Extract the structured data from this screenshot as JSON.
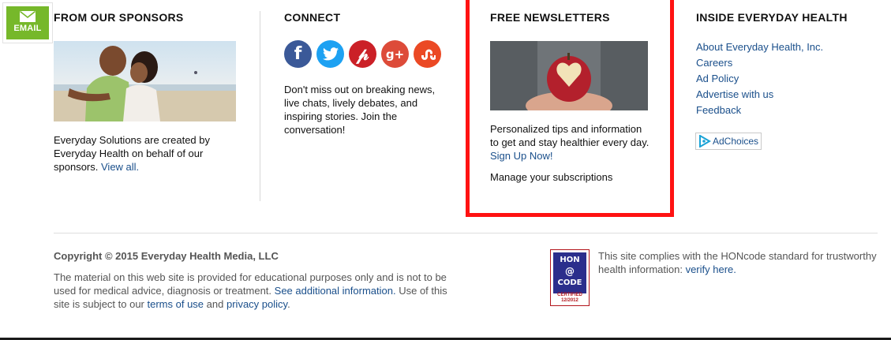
{
  "email": {
    "label": "EMAIL",
    "icon": "envelope-icon"
  },
  "sponsors": {
    "heading": "FROM OUR SPONSORS",
    "text": "Everyday Solutions are created by Everyday Health on behalf of our sponsors.",
    "link": "View all."
  },
  "connect": {
    "heading": "CONNECT",
    "icons": [
      {
        "name": "facebook-icon",
        "glyph": "f",
        "color": "#3b5998"
      },
      {
        "name": "twitter-icon",
        "glyph": "t",
        "color": "#1da1f2"
      },
      {
        "name": "pinterest-icon",
        "glyph": "P",
        "color": "#cb2027"
      },
      {
        "name": "google-plus-icon",
        "glyph": "g+",
        "color": "#dd4b39"
      },
      {
        "name": "stumbleupon-icon",
        "glyph": "su",
        "color": "#eb4924"
      }
    ],
    "text": "Don't miss out on breaking news, live chats, lively debates, and inspiring stories. Join the conversation!"
  },
  "newsletters": {
    "heading": "FREE NEWSLETTERS",
    "text": "Personalized tips and information to get and stay healthier every day.",
    "signup": "Sign Up Now!",
    "manage": "Manage your subscriptions"
  },
  "inside": {
    "heading": "INSIDE EVERYDAY HEALTH",
    "links": [
      "About Everyday Health, Inc.",
      "Careers",
      "Ad Policy",
      "Advertise with us",
      "Feedback"
    ],
    "adchoices": "AdChoices"
  },
  "footer": {
    "copyright": "Copyright © 2015 Everyday Health Media, LLC",
    "disclaimer_1": "The material on this web site is provided for educational purposes only and is not to be used for medical advice, diagnosis or treatment.",
    "disclaimer_link": "See additional information.",
    "disclaimer_2": "Use of this site is subject to our",
    "terms": "terms of use",
    "and": "and",
    "privacy": "privacy policy",
    "hon_text": "This site complies with the HONcode standard for trustworthy health information:",
    "hon_link": "verify here.",
    "hon_badge": {
      "line1": "HON",
      "line2": "@",
      "line3": "CODE",
      "cert": "CERTIFIED",
      "date": "12/2012"
    }
  },
  "colors": {
    "email_green": "#76b82a",
    "link": "#1a4f8b",
    "highlight": "#ff1212"
  }
}
